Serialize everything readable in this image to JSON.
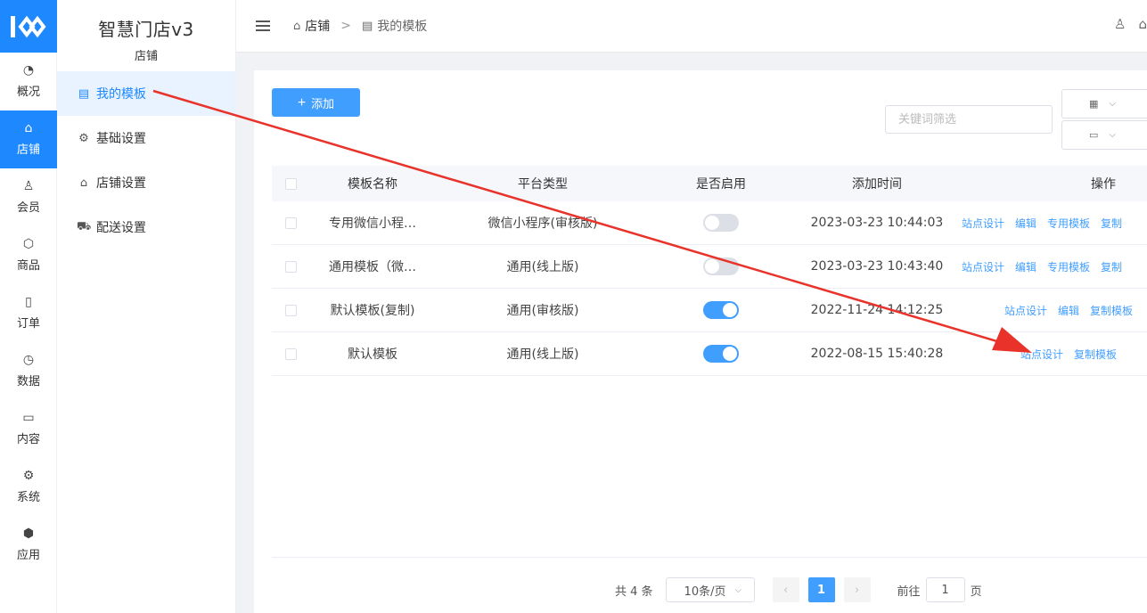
{
  "rail": {
    "items": [
      {
        "label": "概况",
        "icon": "dashboard-icon"
      },
      {
        "label": "店铺",
        "icon": "store-icon",
        "active": true
      },
      {
        "label": "会员",
        "icon": "user-icon"
      },
      {
        "label": "商品",
        "icon": "box-icon"
      },
      {
        "label": "订单",
        "icon": "clipboard-icon"
      },
      {
        "label": "数据",
        "icon": "pie-chart-icon"
      },
      {
        "label": "内容",
        "icon": "folder-icon"
      },
      {
        "label": "系统",
        "icon": "gear-icon"
      },
      {
        "label": "应用",
        "icon": "cube-icon"
      }
    ]
  },
  "sidebar": {
    "title": "智慧门店v3",
    "subtitle": "店铺",
    "items": [
      {
        "label": "我的模板",
        "icon": "template-icon",
        "active": true
      },
      {
        "label": "基础设置",
        "icon": "gear-icon"
      },
      {
        "label": "店铺设置",
        "icon": "store-settings-icon"
      },
      {
        "label": "配送设置",
        "icon": "truck-icon"
      }
    ]
  },
  "breadcrumb": {
    "root": "店铺",
    "separator": ">",
    "current": "我的模板"
  },
  "toolbar": {
    "add_label": "添加",
    "add_plus": "+",
    "search_placeholder": "关键词筛选"
  },
  "table": {
    "headers": {
      "name": "模板名称",
      "platform": "平台类型",
      "enabled": "是否启用",
      "time": "添加时间",
      "ops": "操作"
    },
    "rows": [
      {
        "name": "专用微信小程…",
        "platform": "微信小程序(审核版)",
        "enabled": false,
        "time": "2023-03-23 10:44:03",
        "ops": [
          "站点设计",
          "编辑",
          "专用模板",
          "复制"
        ]
      },
      {
        "name": "通用模板（微…",
        "platform": "通用(线上版)",
        "enabled": false,
        "time": "2023-03-23 10:43:40",
        "ops": [
          "站点设计",
          "编辑",
          "专用模板",
          "复制"
        ]
      },
      {
        "name": "默认模板(复制)",
        "platform": "通用(审核版)",
        "enabled": true,
        "time": "2022-11-24 14:12:25",
        "ops": [
          "站点设计",
          "编辑",
          "复制模板"
        ]
      },
      {
        "name": "默认模板",
        "platform": "通用(线上版)",
        "enabled": true,
        "time": "2022-08-15 15:40:28",
        "ops": [
          "站点设计",
          "复制模板"
        ]
      }
    ]
  },
  "pagination": {
    "total": "共 4 条",
    "page_size": "10条/页",
    "prev": "‹",
    "next": "›",
    "current_page": "1",
    "goto_label": "前往",
    "goto_value": "1",
    "page_suffix": "页"
  },
  "colors": {
    "primary": "#409eff",
    "rail_active": "#1e88ff",
    "annotation_arrow": "#e8322a"
  }
}
